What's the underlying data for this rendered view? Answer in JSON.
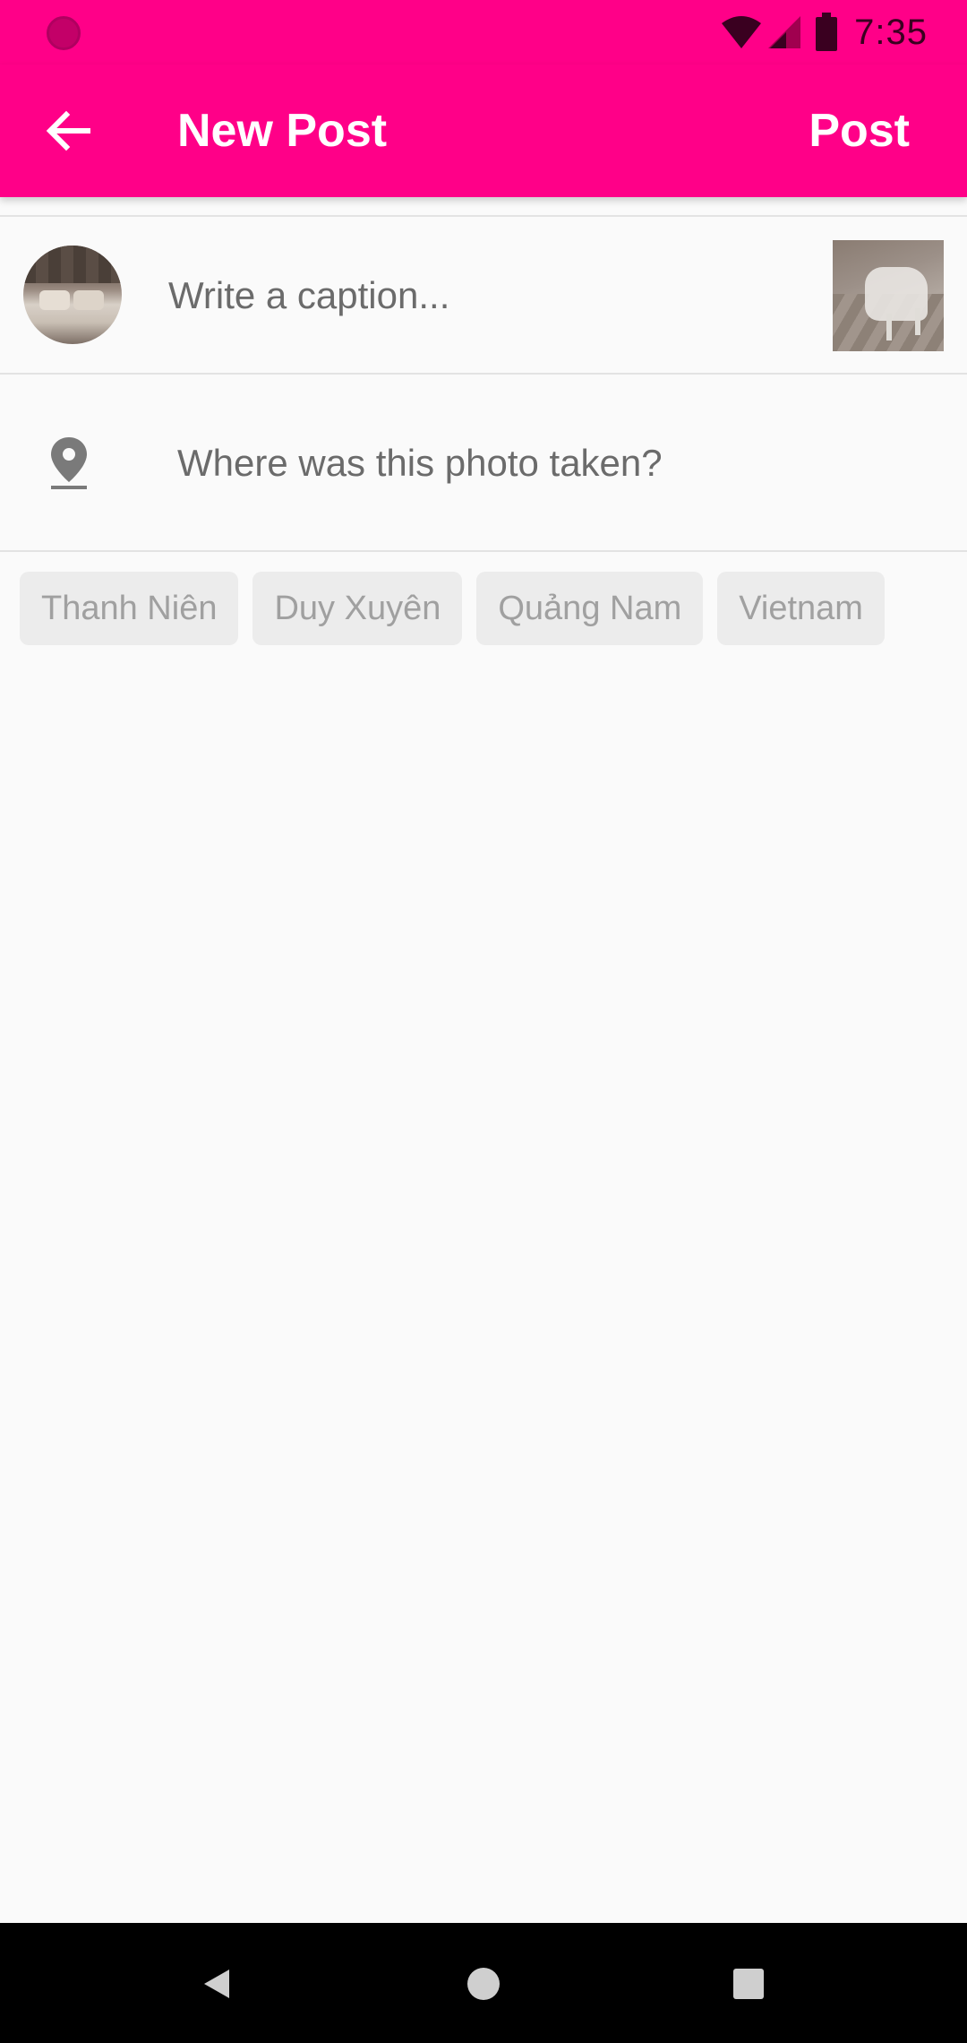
{
  "status_bar": {
    "time": "7:35",
    "icons": [
      "wifi-icon",
      "signal-icon",
      "battery-icon"
    ]
  },
  "app_bar": {
    "title": "New Post",
    "back_icon": "arrow-back-icon",
    "post_label": "Post"
  },
  "caption": {
    "placeholder": "Write a caption...",
    "value": ""
  },
  "location": {
    "icon": "location-pin-icon",
    "label": "Where was this photo taken?"
  },
  "location_suggestions": [
    {
      "label": "Thanh Niên"
    },
    {
      "label": "Duy Xuyên"
    },
    {
      "label": "Quảng Nam"
    },
    {
      "label": "Vietnam"
    }
  ],
  "nav_bar": {
    "icons": [
      "back-triangle-icon",
      "home-circle-icon",
      "recents-square-icon"
    ]
  },
  "colors": {
    "accent": "#ff0088",
    "background": "#fafafa",
    "chip_bg": "#ececec",
    "chip_text": "#a0a0a0"
  }
}
